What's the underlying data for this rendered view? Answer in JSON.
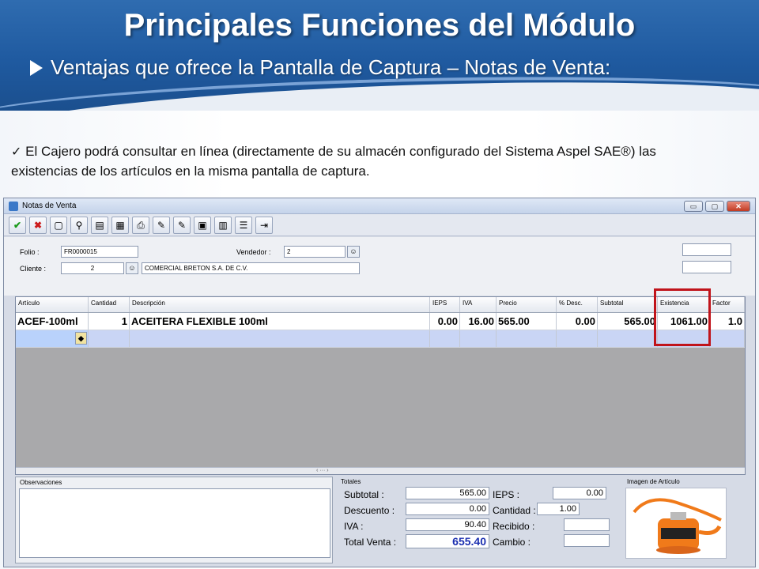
{
  "slide": {
    "title": "Principales Funciones del Módulo",
    "subtitle": "Ventajas que ofrece la Pantalla de Captura – Notas de Venta:",
    "note": "El Cajero podrá consultar en línea (directamente de su almacén configurado del Sistema Aspel SAE®) las existencias de los artículos en la misma pantalla de captura."
  },
  "window": {
    "title": "Notas de Venta",
    "buttons": {
      "minimize": "▭",
      "maximize": "▢",
      "close": "✕"
    }
  },
  "toolbar": {
    "icons": [
      "check-icon",
      "cancel-icon",
      "new-icon",
      "search-icon",
      "document-icon",
      "excel-icon",
      "print-icon",
      "tag-icon",
      "tag2-icon",
      "note-icon",
      "calculator-icon",
      "list-icon",
      "exit-icon"
    ],
    "glyphs": [
      "✔",
      "✖",
      "▢",
      "⚲",
      "▤",
      "▦",
      "⎙",
      "✎",
      "✎",
      "▣",
      "▥",
      "☰",
      "⇥"
    ]
  },
  "form": {
    "folio_label": "Folio :",
    "folio_value": "FR0000015",
    "vendedor_label": "Vendedor :",
    "vendedor_value": "2",
    "cliente_label": "Cliente :",
    "cliente_value": "2",
    "cliente_name": "COMERCIAL BRETON S.A. DE C.V."
  },
  "grid": {
    "columns": [
      "Artículo",
      "Cantidad",
      "Descripción",
      "IEPS",
      "IVA",
      "Precio",
      "% Desc.",
      "Subtotal",
      "Existencia",
      "Factor"
    ],
    "row": {
      "articulo": "ACEF-100ml",
      "cantidad": "1",
      "descripcion": "ACEITERA FLEXIBLE 100ml",
      "ieps": "0.00",
      "iva": "16.00",
      "precio": "565.00",
      "desc": "0.00",
      "subtotal": "565.00",
      "existencia": "1061.00",
      "factor": "1.0"
    },
    "scroll_mark": "‹ ··· ›"
  },
  "bottom": {
    "observaciones_label": "Observaciones",
    "totales_label": "Totales",
    "imagen_label": "Imagen de Artículo",
    "subtotal_label": "Subtotal :",
    "subtotal_value": "565.00",
    "descuento_label": "Descuento :",
    "descuento_value": "0.00",
    "iva_label": "IVA :",
    "iva_value": "90.40",
    "total_label": "Total Venta :",
    "total_value": "655.40",
    "ieps_label": "IEPS :",
    "ieps_value": "0.00",
    "cantidad_label": "Cantidad :",
    "cantidad_value": "1.00",
    "recibido_label": "Recibido :",
    "recibido_value": "",
    "cambio_label": "Cambio :",
    "cambio_value": ""
  }
}
